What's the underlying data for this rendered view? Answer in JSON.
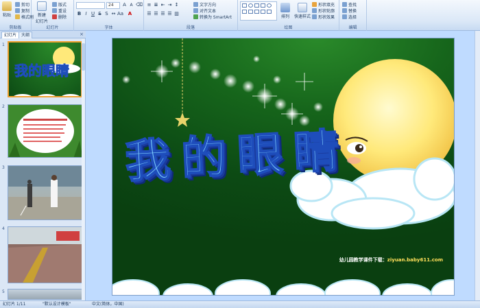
{
  "ribbon": {
    "groups": [
      {
        "label": "剪贴板"
      },
      {
        "label": "幻灯片"
      },
      {
        "label": "字体"
      },
      {
        "label": "段落"
      },
      {
        "label": "绘图"
      },
      {
        "label": "编辑"
      }
    ],
    "clipboard": {
      "paste": "粘贴",
      "cut": "剪切",
      "copy": "复制",
      "format_painter": "格式刷"
    },
    "slides": {
      "new_slide": "新建\n幻灯片",
      "layout": "版式",
      "reset": "重设",
      "delete": "删除"
    },
    "font": {
      "font_name": "",
      "font_size": "24"
    },
    "paragraph": {
      "text_direction": "文字方向",
      "align_text": "对齐文本",
      "smartart": "转换为 SmartArt"
    },
    "drawing": {
      "arrange": "排列",
      "quick_styles": "快速样式",
      "fill": "形状填充",
      "outline": "形状轮廓",
      "effects": "形状效果"
    },
    "editing": {
      "find": "查找",
      "replace": "替换",
      "select": "选择"
    }
  },
  "panel": {
    "tab_slides": "幻灯片",
    "tab_outline": "大纲",
    "close": "×",
    "thumbnails": [
      {
        "num": "1"
      },
      {
        "num": "2"
      },
      {
        "num": "3"
      },
      {
        "num": "4"
      },
      {
        "num": "5"
      }
    ]
  },
  "slide": {
    "title": "我的眼睛",
    "watermark_prefix": "幼儿园教学课件下载：",
    "watermark_url": "ziyuan.baby611.com"
  },
  "statusbar": {
    "slide_info": "幻灯片 1/11",
    "theme": "\"默认设计模板\"",
    "language": "中文(简体，中国)"
  },
  "colors": {
    "ribbon_bg": "#dbe8f7",
    "slide_green": "#16651b",
    "title_blue": "#7fd1ff",
    "moon_yellow": "#ffe97a",
    "selection_orange": "#f0a030"
  }
}
